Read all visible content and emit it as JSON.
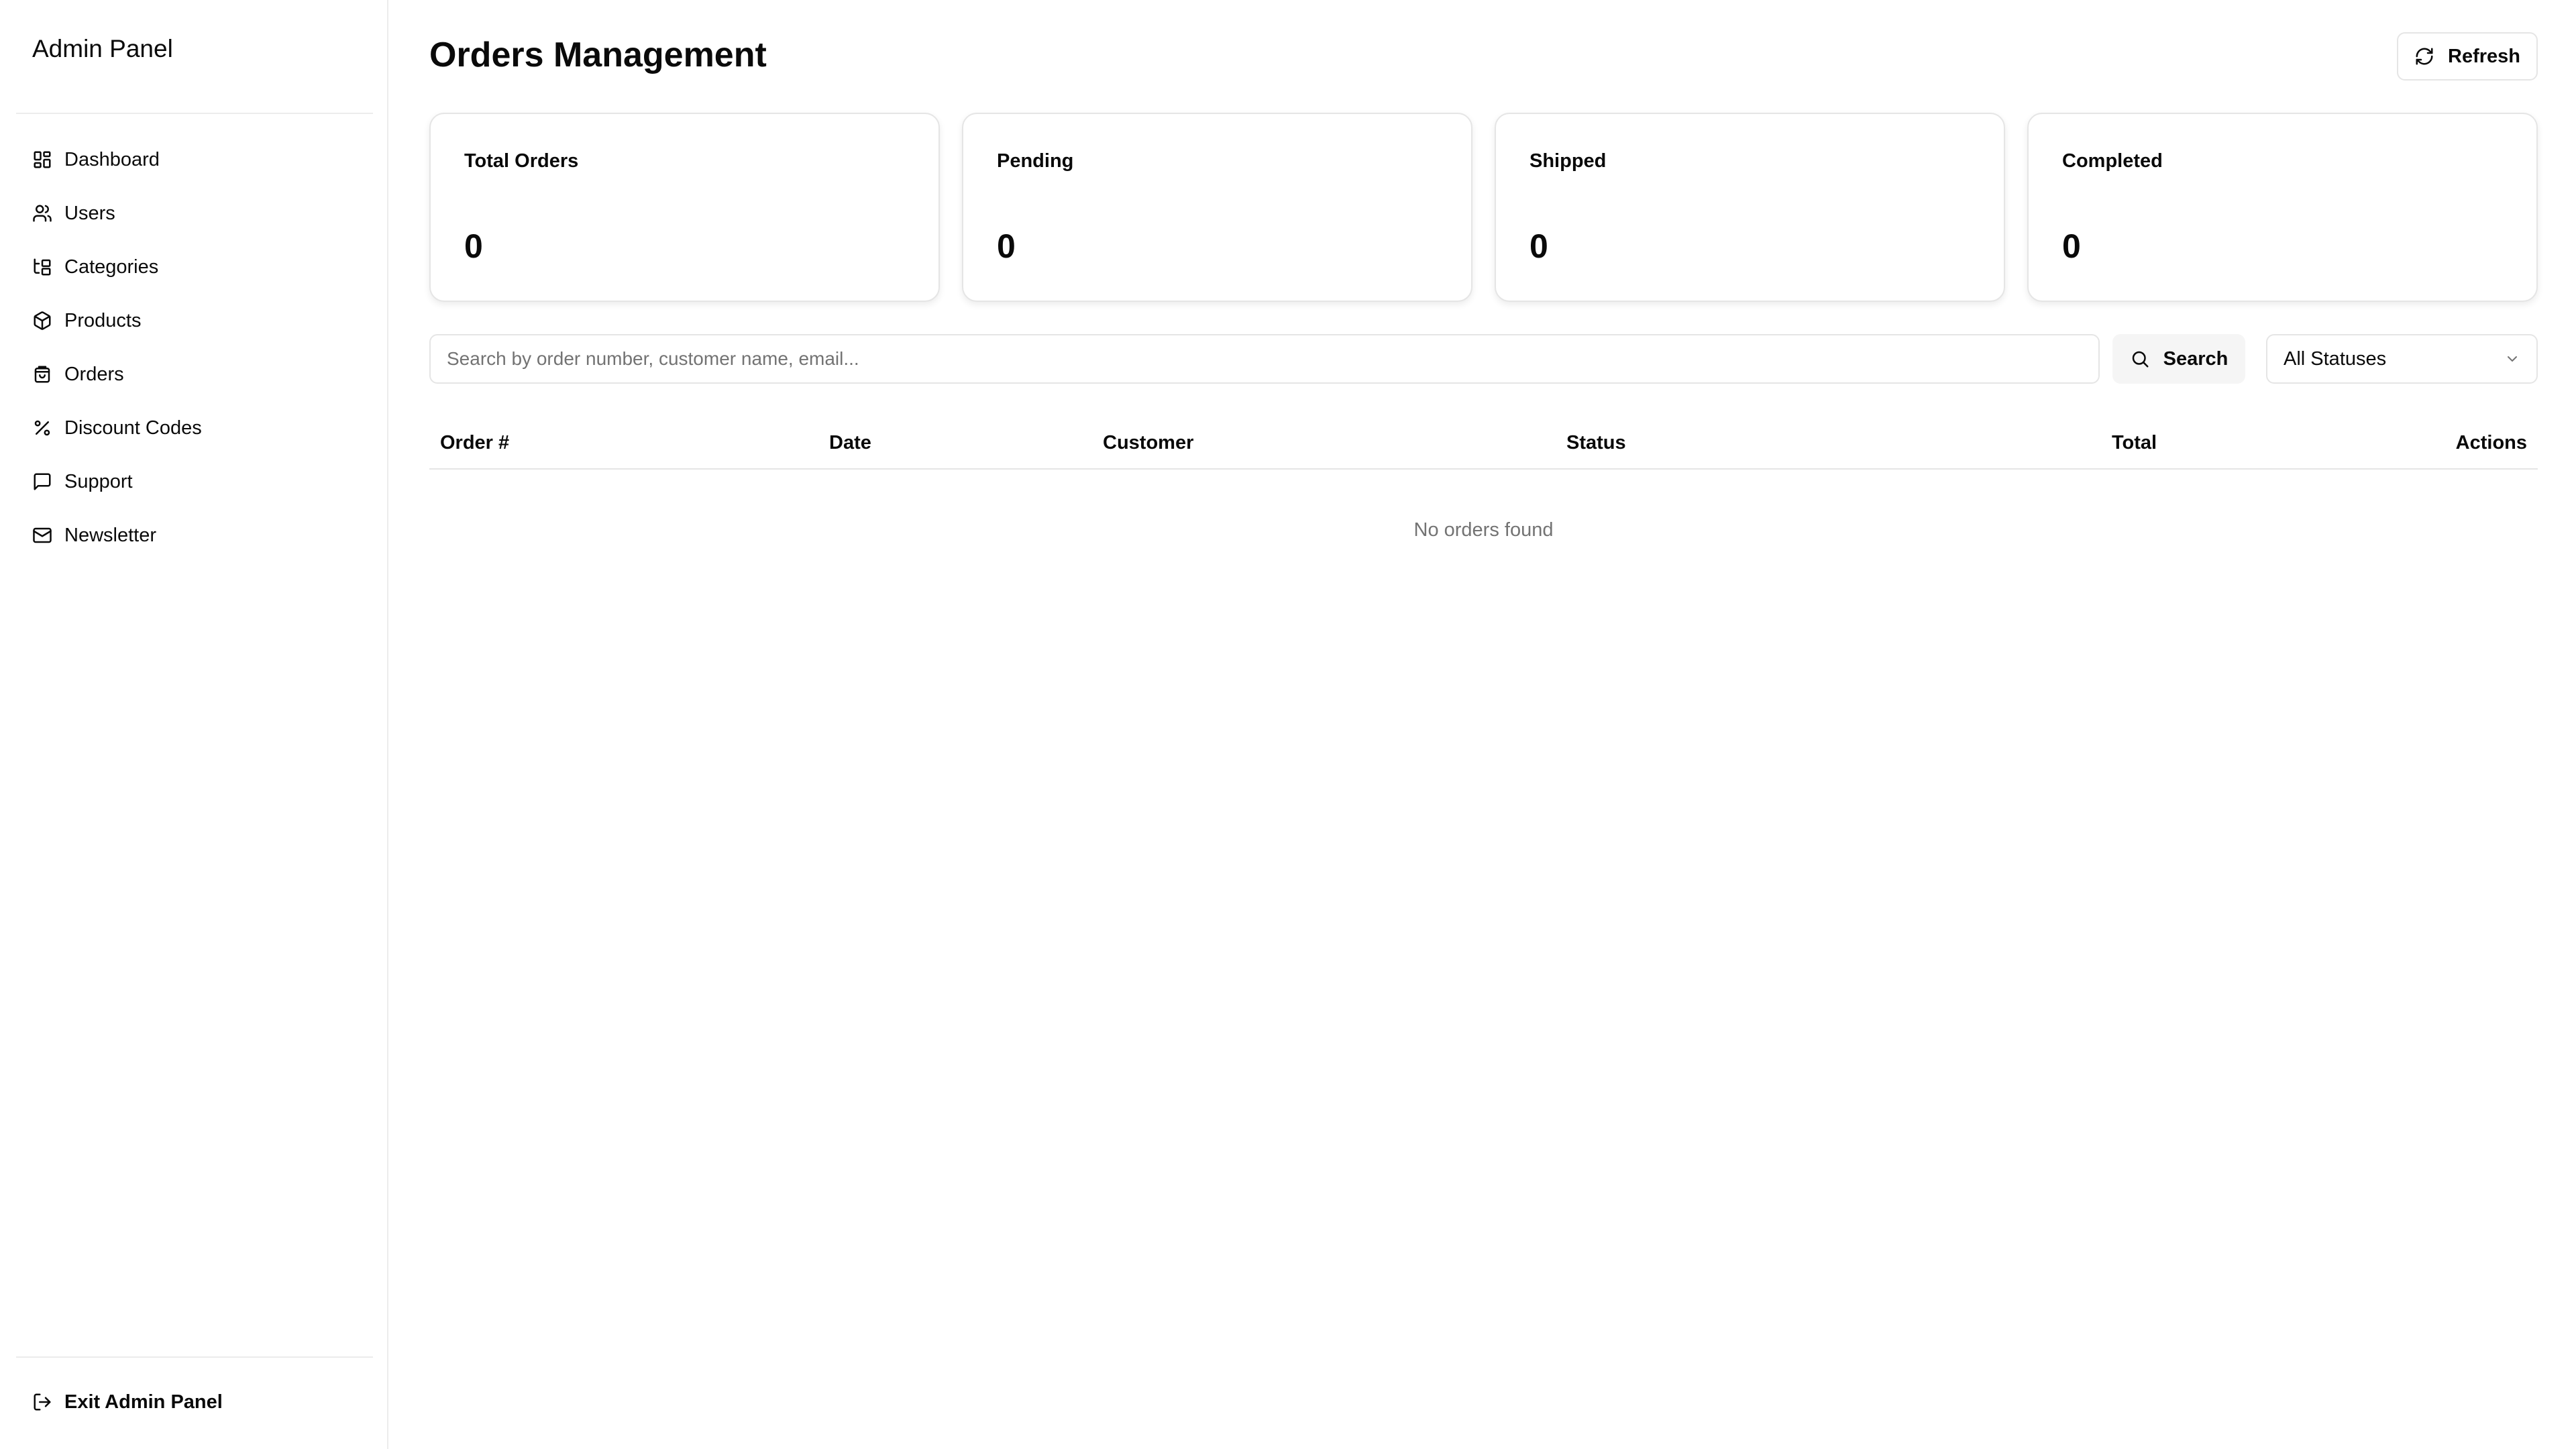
{
  "sidebar": {
    "brand": "Admin Panel",
    "items": [
      {
        "label": "Dashboard",
        "icon": "layout-grid-icon"
      },
      {
        "label": "Users",
        "icon": "users-icon"
      },
      {
        "label": "Categories",
        "icon": "folder-tree-icon"
      },
      {
        "label": "Products",
        "icon": "package-icon"
      },
      {
        "label": "Orders",
        "icon": "shopping-bag-icon"
      },
      {
        "label": "Discount Codes",
        "icon": "percent-icon"
      },
      {
        "label": "Support",
        "icon": "message-square-icon"
      },
      {
        "label": "Newsletter",
        "icon": "mail-icon"
      }
    ],
    "exit_label": "Exit Admin Panel"
  },
  "header": {
    "title": "Orders Management",
    "refresh_label": "Refresh"
  },
  "stats": [
    {
      "label": "Total Orders",
      "value": "0"
    },
    {
      "label": "Pending",
      "value": "0"
    },
    {
      "label": "Shipped",
      "value": "0"
    },
    {
      "label": "Completed",
      "value": "0"
    }
  ],
  "filters": {
    "search_placeholder": "Search by order number, customer name, email...",
    "search_value": "",
    "search_button": "Search",
    "status_selected": "All Statuses"
  },
  "table": {
    "columns": [
      "Order #",
      "Date",
      "Customer",
      "Status",
      "Total",
      "Actions"
    ],
    "empty_message": "No orders found"
  }
}
